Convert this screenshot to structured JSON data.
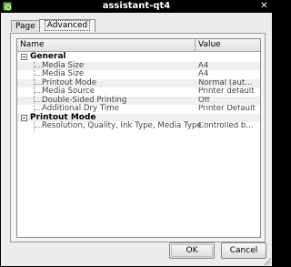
{
  "window": {
    "title": "assistant-qt4",
    "close_glyph": "✕"
  },
  "tabs": [
    {
      "label": "Page"
    },
    {
      "label": "Advanced"
    }
  ],
  "columns": {
    "name": "Name",
    "value": "Value"
  },
  "tree": [
    {
      "label": "General",
      "value": "",
      "group": true
    },
    {
      "label": "Media Size",
      "value": "A4"
    },
    {
      "label": "Media Size",
      "value": "A4"
    },
    {
      "label": "Printout Mode",
      "value": "Normal (aut..."
    },
    {
      "label": "Media Source",
      "value": "Printer default"
    },
    {
      "label": "Double-Sided Printing",
      "value": "Off"
    },
    {
      "label": "Additional Dry Time",
      "value": "Printer Default"
    },
    {
      "label": "Printout Mode",
      "value": "",
      "group": true
    },
    {
      "label": "Resolution, Quality, Ink Type, Media Type",
      "value": "Controlled b..."
    }
  ],
  "buttons": {
    "ok": "OK",
    "cancel": "Cancel"
  }
}
